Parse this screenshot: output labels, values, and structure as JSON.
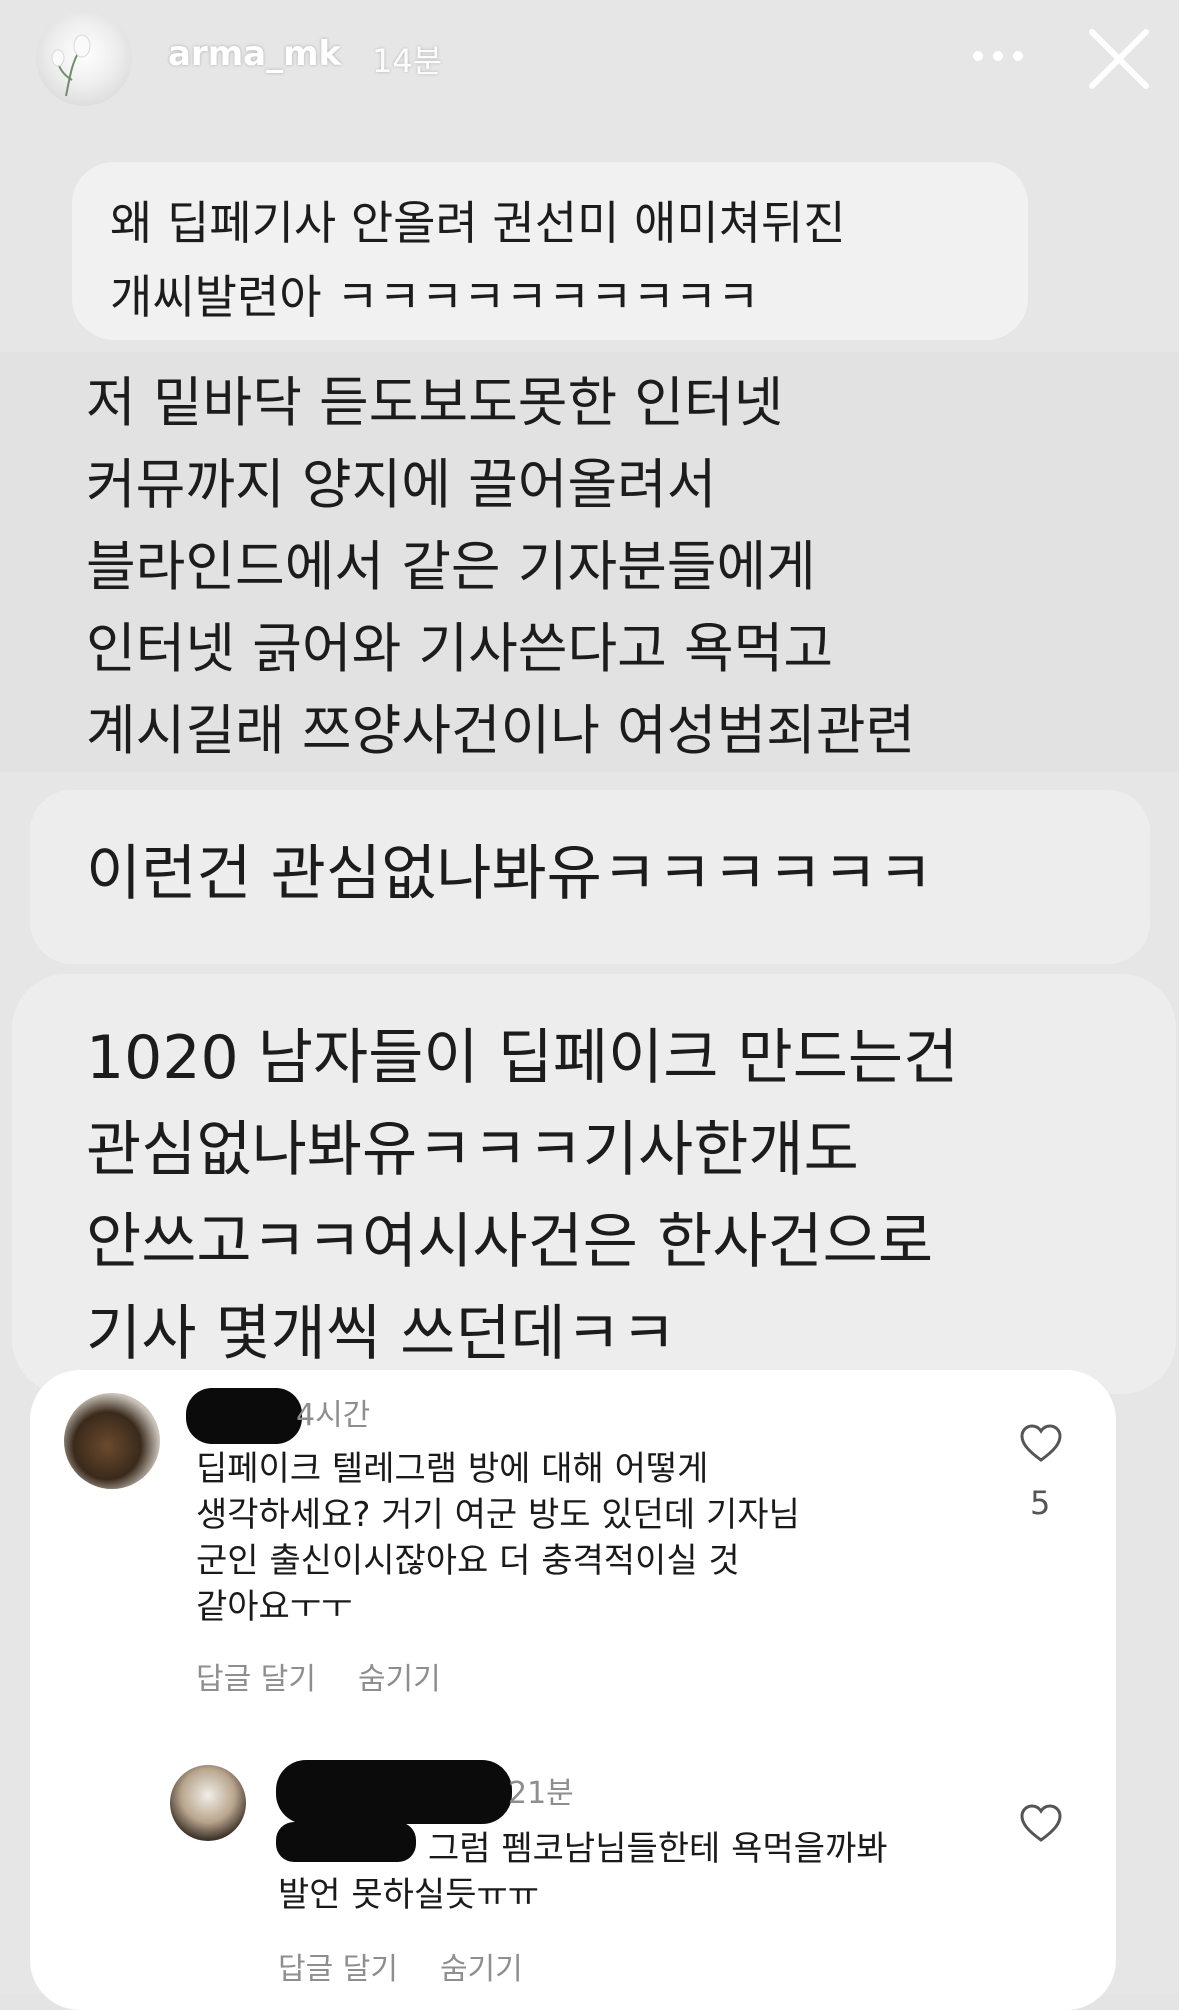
{
  "story": {
    "username": "arma_mk",
    "time_ago": "14분",
    "icons": {
      "more": "more-horizontal-icon",
      "close": "close-icon"
    }
  },
  "messages": [
    {
      "text": "왜 딥페기사 안올려 권선미 애미쳐뒤진\n개씨발련아 ㅋㅋㅋㅋㅋㅋㅋㅋㅋㅋ"
    },
    {
      "text": "저 밑바닥 듣도보도못한 인터넷\n커뮤까지 양지에 끌어올려서\n블라인드에서 같은 기자분들에게\n인터넷 긁어와 기사쓴다고 욕먹고\n계시길래 쯔양사건이나 여성범죄관련"
    },
    {
      "text": "이런건 관심없나봐유ㅋㅋㅋㅋㅋㅋ"
    },
    {
      "text": "1020 남자들이 딥페이크 만드는건\n관심없나봐유ㅋㅋㅋ기사한개도\n안쓰고ㅋㅋ여시사건은 한사건으로\n기사 몇개씩 쓰던데ㅋㅋ"
    }
  ],
  "comments": [
    {
      "time": "4시간",
      "text": "딥페이크 텔레그램 방에 대해 어떻게\n생각하세요? 거기 여군 방도 있던데 기자님\n군인 출신이시잖아요 더 충격적이실 것\n같아요ㅜㅜ",
      "likes": "5",
      "reply_label": "답글 달기",
      "hide_label": "숨기기"
    },
    {
      "time": "21분",
      "text": "그럼 펨코남님들한테 욕먹을까봐\n발언 못하실듯ㅠㅠ",
      "reply_label": "답글 달기",
      "hide_label": "숨기기"
    }
  ]
}
